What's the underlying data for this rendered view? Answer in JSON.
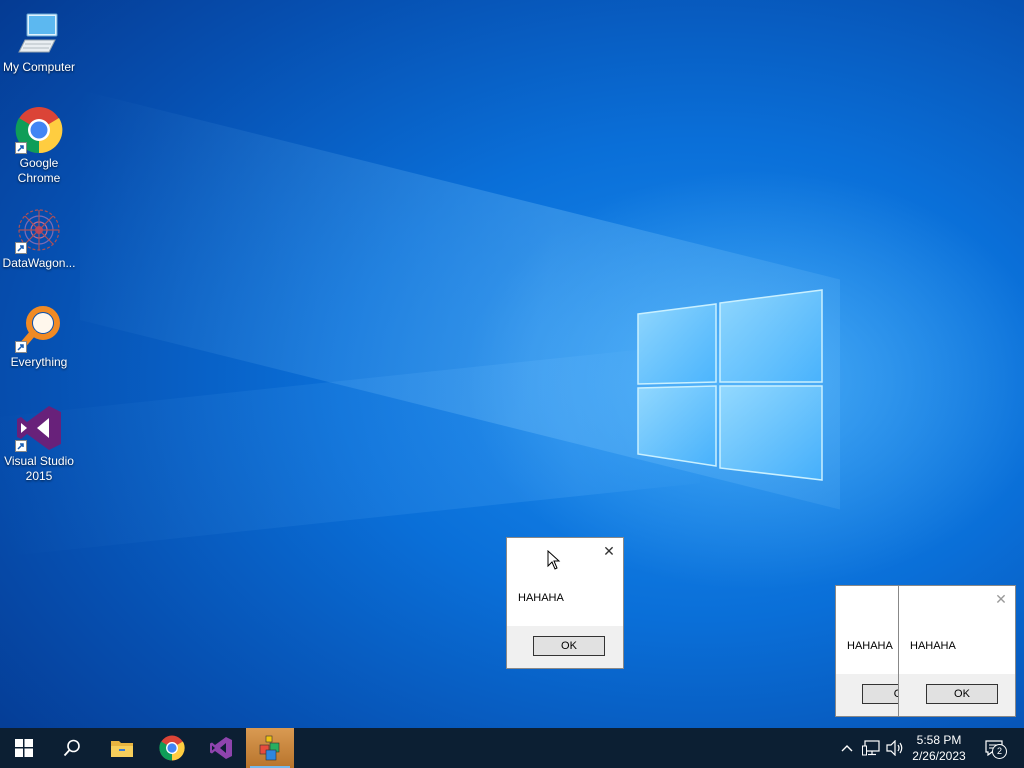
{
  "desktop": {
    "icons": [
      {
        "label": "My Computer",
        "icon": "computer-icon"
      },
      {
        "label": "Google\nChrome",
        "icon": "chrome-icon",
        "shortcut": true
      },
      {
        "label": "DataWagon...",
        "icon": "datawagon-icon",
        "shortcut": true
      },
      {
        "label": "Everything",
        "icon": "everything-search-icon",
        "shortcut": true
      },
      {
        "label": "Visual Studio\n2015",
        "icon": "visual-studio-icon",
        "shortcut": true
      }
    ]
  },
  "dialogs": [
    {
      "message": "HAHAHA",
      "ok_label": "OK",
      "close_glyph": "✕"
    },
    {
      "message": "HAHAHA",
      "ok_label": "O"
    },
    {
      "message": "HAHAHA",
      "ok_label": "OK",
      "close_glyph": "✕"
    }
  ],
  "taskbar": {
    "start": "start-icon",
    "search": "search-icon",
    "pinned": [
      "file-explorer-icon",
      "chrome-icon",
      "visual-studio-icon",
      "app-cubes-icon"
    ],
    "tray": {
      "chevron": "show-hidden-icons-icon",
      "network": "network-icon",
      "volume": "volume-icon"
    },
    "time": "5:58 PM",
    "date": "2/26/2023",
    "notification_count": "2"
  },
  "colors": {
    "wallpaper": "#0a6fd8",
    "taskbar": "#0c1f33",
    "active_app": "#d99a52",
    "running_indicator": "#76b9ed"
  }
}
